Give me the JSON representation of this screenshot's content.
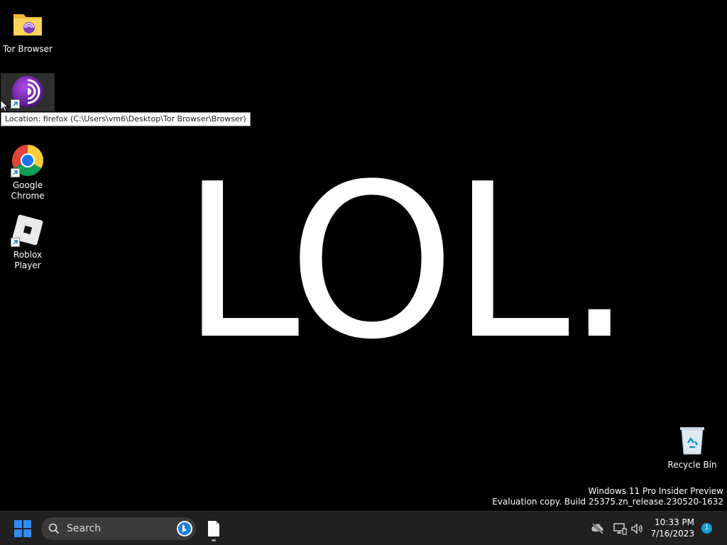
{
  "desktop": {
    "big_text": "LOL.",
    "icons": [
      {
        "label": "Tor Browser",
        "type": "folder"
      },
      {
        "label": "",
        "type": "tor-shortcut"
      },
      {
        "label": "Google Chrome",
        "type": "chrome"
      },
      {
        "label": "Roblox Player",
        "type": "roblox"
      },
      {
        "label": "Recycle Bin",
        "type": "recycle-bin"
      }
    ],
    "tooltip": "Location: firefox (C:\\Users\\vm6\\Desktop\\Tor Browser\\Browser)",
    "watermark": {
      "line1": "Windows 11 Pro Insider Preview",
      "line2": "Evaluation copy. Build 25375.zn_release.230520-1632"
    }
  },
  "taskbar": {
    "search_label": "Search",
    "clock": {
      "time": "10:33 PM",
      "date": "7/16/2023"
    },
    "notification_count": "1",
    "colors": {
      "background": "#202020",
      "accent": "#1a9bd7",
      "start": "#2f8bf5"
    }
  }
}
